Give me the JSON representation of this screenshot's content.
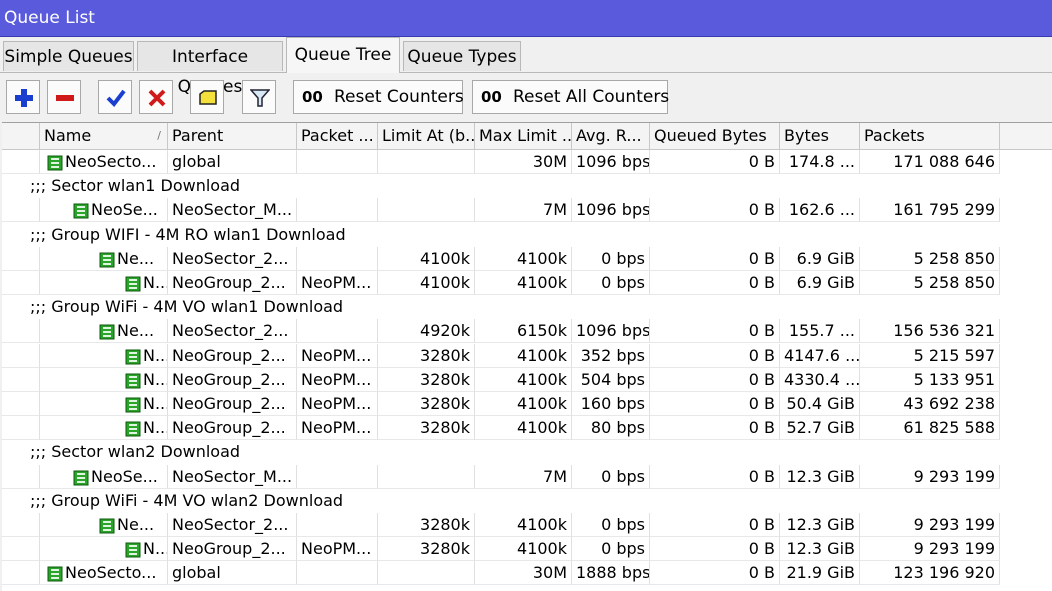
{
  "window": {
    "title": "Queue List"
  },
  "tabs": [
    {
      "label": "Simple Queues"
    },
    {
      "label": "Interface Queues"
    },
    {
      "label": "Queue Tree"
    },
    {
      "label": "Queue Types"
    }
  ],
  "toolbar": {
    "reset_counters": "Reset Counters",
    "reset_all_counters": "Reset All Counters",
    "oo": "00"
  },
  "columns": [
    "Name",
    "Parent",
    "Packet ...",
    "Limit At (b...",
    "Max Limit ...",
    "Avg. R...",
    "Queued Bytes",
    "Bytes",
    "Packets"
  ],
  "colors": {
    "title_bar": "#5a5adc",
    "queue_icon": "#2aa42a",
    "add": "#1a3fd0",
    "remove": "#d01a1a"
  },
  "rows": [
    {
      "type": "item",
      "indent": 0,
      "name": "NeoSecto...",
      "parent": "global",
      "packet": "",
      "limit_at": "",
      "max_limit": "30M",
      "avg": "1096 bps",
      "queued": "0 B",
      "bytes": "174.8 ...",
      "packets": "171 088 646"
    },
    {
      "type": "comment",
      "text": ";;; Sector wlan1 Download"
    },
    {
      "type": "item",
      "indent": 1,
      "name": "NeoSe...",
      "parent": "NeoSector_M...",
      "packet": "",
      "limit_at": "",
      "max_limit": "7M",
      "avg": "1096 bps",
      "queued": "0 B",
      "bytes": "162.6 ...",
      "packets": "161 795 299"
    },
    {
      "type": "comment",
      "text": ";;; Group WIFI - 4M RO wlan1 Download"
    },
    {
      "type": "item",
      "indent": 2,
      "name": "Ne...",
      "parent": "NeoSector_2...",
      "packet": "",
      "limit_at": "4100k",
      "max_limit": "4100k",
      "avg": "0 bps",
      "queued": "0 B",
      "bytes": "6.9 GiB",
      "packets": "5 258 850"
    },
    {
      "type": "item",
      "indent": 3,
      "name": "N...",
      "parent": "NeoGroup_2...",
      "packet": "NeoPM...",
      "limit_at": "4100k",
      "max_limit": "4100k",
      "avg": "0 bps",
      "queued": "0 B",
      "bytes": "6.9 GiB",
      "packets": "5 258 850"
    },
    {
      "type": "comment",
      "text": ";;; Group WiFi - 4M VO wlan1 Download"
    },
    {
      "type": "item",
      "indent": 2,
      "name": "Ne...",
      "parent": "NeoSector_2...",
      "packet": "",
      "limit_at": "4920k",
      "max_limit": "6150k",
      "avg": "1096 bps",
      "queued": "0 B",
      "bytes": "155.7 ...",
      "packets": "156 536 321"
    },
    {
      "type": "item",
      "indent": 3,
      "name": "N...",
      "parent": "NeoGroup_2...",
      "packet": "NeoPM...",
      "limit_at": "3280k",
      "max_limit": "4100k",
      "avg": "352 bps",
      "queued": "0 B",
      "bytes": "4147.6 ...",
      "packets": "5 215 597"
    },
    {
      "type": "item",
      "indent": 3,
      "name": "N...",
      "parent": "NeoGroup_2...",
      "packet": "NeoPM...",
      "limit_at": "3280k",
      "max_limit": "4100k",
      "avg": "504 bps",
      "queued": "0 B",
      "bytes": "4330.4 ...",
      "packets": "5 133 951"
    },
    {
      "type": "item",
      "indent": 3,
      "name": "N...",
      "parent": "NeoGroup_2...",
      "packet": "NeoPM...",
      "limit_at": "3280k",
      "max_limit": "4100k",
      "avg": "160 bps",
      "queued": "0 B",
      "bytes": "50.4 GiB",
      "packets": "43 692 238"
    },
    {
      "type": "item",
      "indent": 3,
      "name": "N...",
      "parent": "NeoGroup_2...",
      "packet": "NeoPM...",
      "limit_at": "3280k",
      "max_limit": "4100k",
      "avg": "80 bps",
      "queued": "0 B",
      "bytes": "52.7 GiB",
      "packets": "61 825 588"
    },
    {
      "type": "comment",
      "text": ";;; Sector wlan2 Download"
    },
    {
      "type": "item",
      "indent": 1,
      "name": "NeoSe...",
      "parent": "NeoSector_M...",
      "packet": "",
      "limit_at": "",
      "max_limit": "7M",
      "avg": "0 bps",
      "queued": "0 B",
      "bytes": "12.3 GiB",
      "packets": "9 293 199"
    },
    {
      "type": "comment",
      "text": ";;; Group WiFi - 4M VO wlan2 Download"
    },
    {
      "type": "item",
      "indent": 2,
      "name": "Ne...",
      "parent": "NeoSector_2...",
      "packet": "",
      "limit_at": "3280k",
      "max_limit": "4100k",
      "avg": "0 bps",
      "queued": "0 B",
      "bytes": "12.3 GiB",
      "packets": "9 293 199"
    },
    {
      "type": "item",
      "indent": 3,
      "name": "N...",
      "parent": "NeoGroup_2...",
      "packet": "NeoPM...",
      "limit_at": "3280k",
      "max_limit": "4100k",
      "avg": "0 bps",
      "queued": "0 B",
      "bytes": "12.3 GiB",
      "packets": "9 293 199"
    },
    {
      "type": "item",
      "indent": 0,
      "name": "NeoSecto...",
      "parent": "global",
      "packet": "",
      "limit_at": "",
      "max_limit": "30M",
      "avg": "1888 bps",
      "queued": "0 B",
      "bytes": "21.9 GiB",
      "packets": "123 196 920"
    }
  ]
}
